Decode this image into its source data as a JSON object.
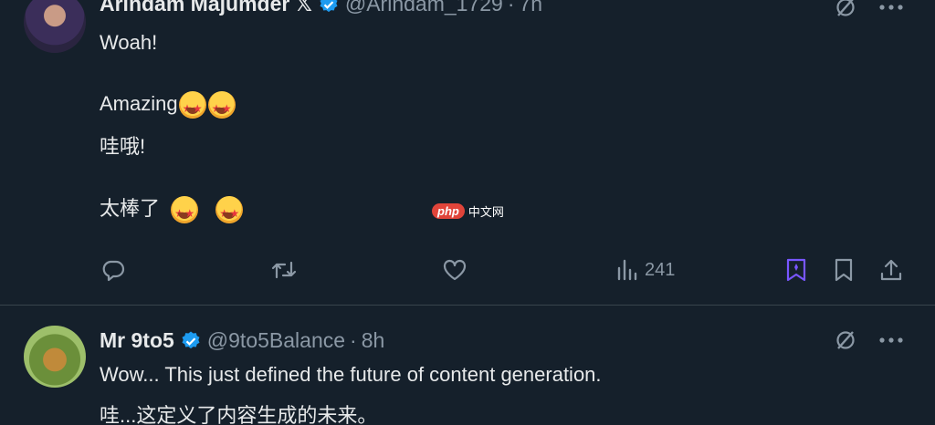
{
  "tweets": [
    {
      "author": {
        "display_name": "Arindam Majumder",
        "badge": "𝕏",
        "handle": "@Arindam_1729",
        "time": "7h"
      },
      "lines": [
        "Woah!",
        "Amazing",
        "哇哦!",
        "太棒了"
      ],
      "emoji": "star-struck-emoji",
      "views": "241"
    },
    {
      "author": {
        "display_name": "Mr 9to5",
        "handle": "@9to5Balance",
        "time": "8h"
      },
      "lines": [
        "Wow... This just defined the future of content generation.",
        "哇...这定义了内容生成的未来。"
      ]
    }
  ],
  "separator": "·",
  "watermark": {
    "pill": "php",
    "text": "中文网"
  },
  "colors": {
    "background": "#15202b",
    "text": "#e7e9ea",
    "muted": "#8b98a5",
    "verified": "#1d9bf0",
    "grok": "#7856ff"
  }
}
